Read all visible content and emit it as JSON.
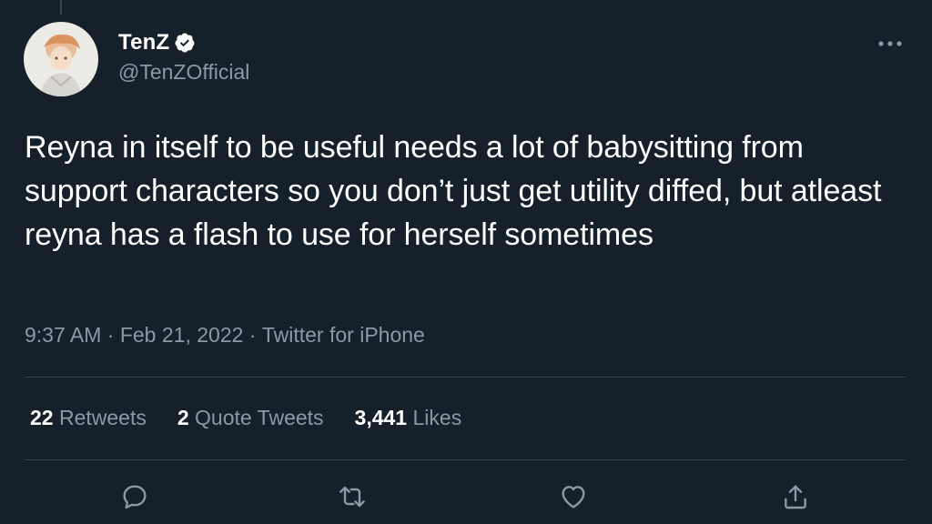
{
  "author": {
    "name": "TenZ",
    "handle": "@TenZOfficial",
    "verified": true
  },
  "tweet": {
    "text": "Reyna in itself to be useful needs a lot of babysitting from support characters so you don’t just get utility diffed, but atleast reyna has a flash to use for herself sometimes",
    "time": "9:37 AM",
    "date": "Feb 21, 2022",
    "source": "Twitter for iPhone",
    "separator": " · "
  },
  "stats": {
    "retweets": {
      "count": "22",
      "label": "Retweets"
    },
    "quote_tweets": {
      "count": "2",
      "label": "Quote Tweets"
    },
    "likes": {
      "count": "3,441",
      "label": "Likes"
    }
  },
  "actions": {
    "icons": [
      "reply-icon",
      "retweet-icon",
      "like-icon",
      "share-icon"
    ]
  },
  "colors": {
    "background": "#15202b",
    "text_primary": "#ffffff",
    "text_secondary": "#8b98a5",
    "divider": "#38444d",
    "verified_badge": "#ffffff"
  }
}
